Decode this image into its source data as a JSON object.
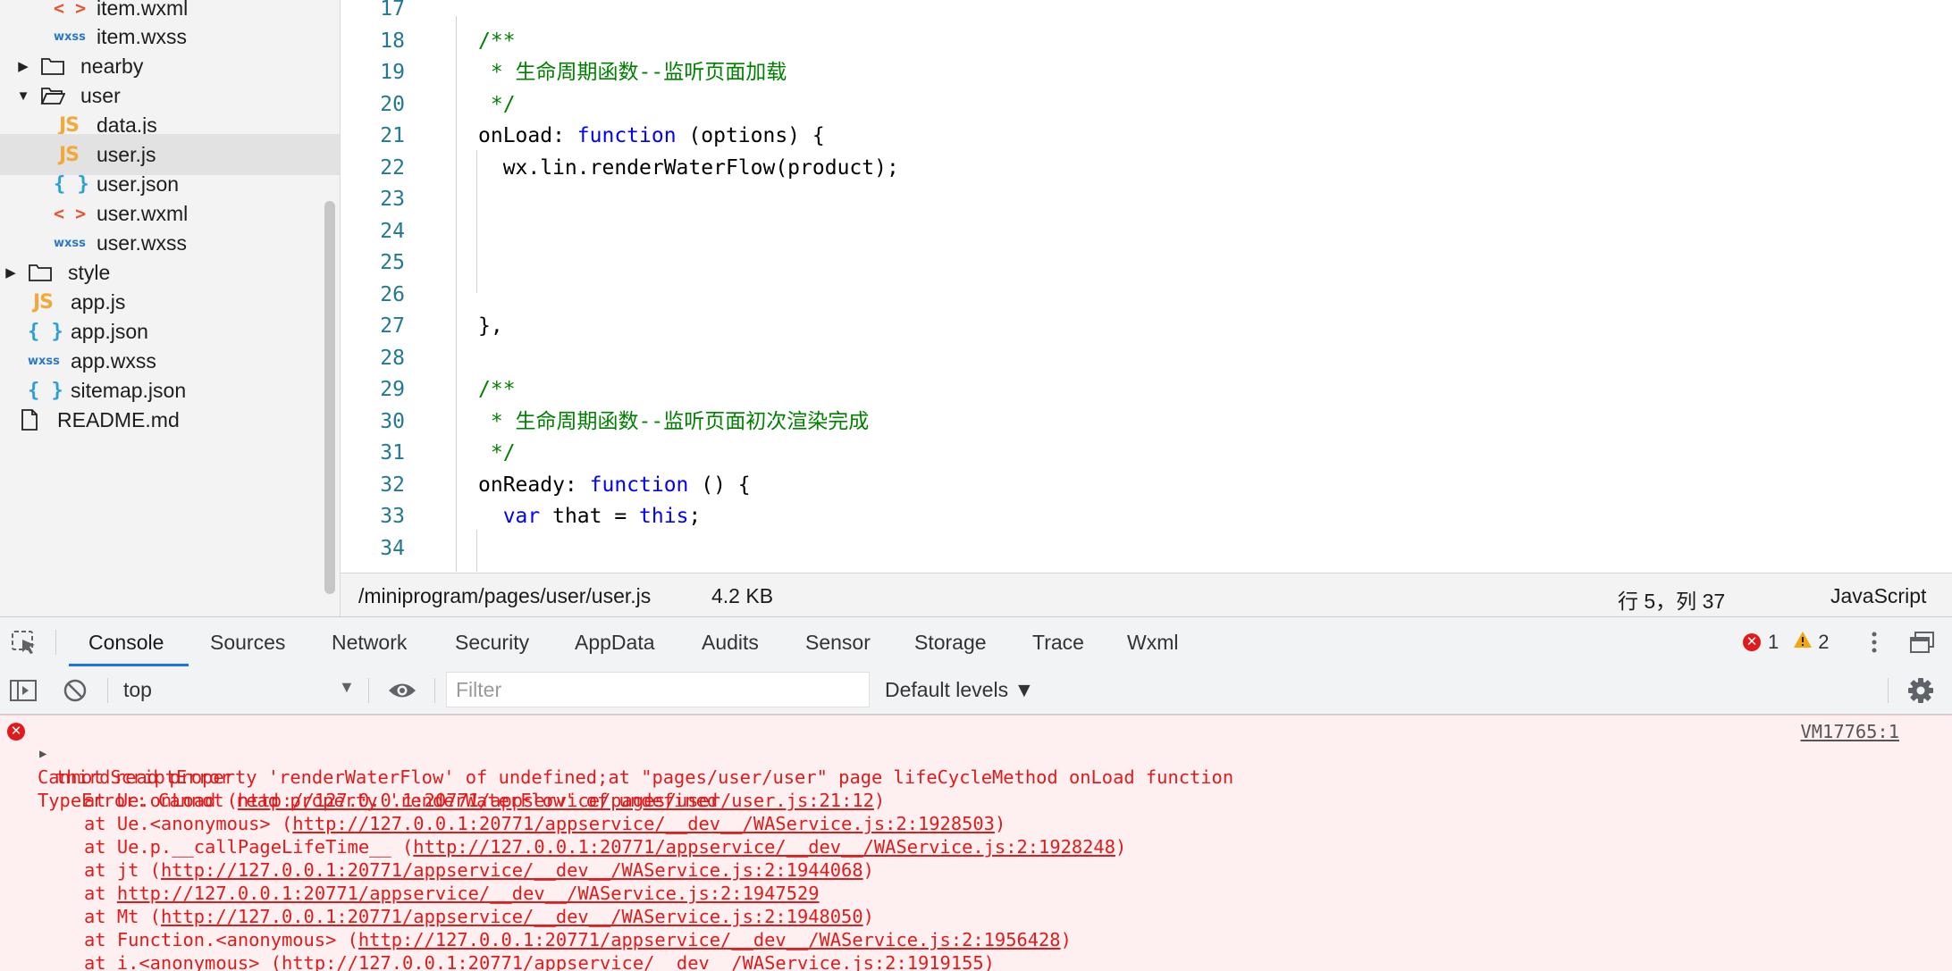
{
  "file_tree": {
    "items": [
      {
        "name": "item.wxml",
        "type": "wxml",
        "icon": "angle-brackets-icon"
      },
      {
        "name": "item.wxss",
        "type": "wxss",
        "icon": "wxss-icon"
      },
      {
        "name": "nearby",
        "type": "folder",
        "expanded": false,
        "icon": "folder-icon"
      },
      {
        "name": "user",
        "type": "folder",
        "expanded": true,
        "icon": "folder-open-icon"
      },
      {
        "name": "data.js",
        "type": "js",
        "icon": "js-icon"
      },
      {
        "name": "user.js",
        "type": "js",
        "icon": "js-icon",
        "selected": true
      },
      {
        "name": "user.json",
        "type": "json",
        "icon": "braces-icon"
      },
      {
        "name": "user.wxml",
        "type": "wxml",
        "icon": "angle-brackets-icon"
      },
      {
        "name": "user.wxss",
        "type": "wxss",
        "icon": "wxss-icon"
      },
      {
        "name": "style",
        "type": "folder",
        "expanded": false,
        "icon": "folder-icon"
      },
      {
        "name": "app.js",
        "type": "js",
        "icon": "js-icon"
      },
      {
        "name": "app.json",
        "type": "json",
        "icon": "braces-icon"
      },
      {
        "name": "app.wxss",
        "type": "wxss",
        "icon": "wxss-icon"
      },
      {
        "name": "sitemap.json",
        "type": "json",
        "icon": "braces-icon"
      },
      {
        "name": "README.md",
        "type": "file",
        "icon": "file-icon"
      }
    ],
    "icon_glyphs": {
      "js": "JS",
      "json": "{ }",
      "wxml": "< >",
      "wxss": "wxss"
    }
  },
  "editor": {
    "lines": [
      {
        "num": "17",
        "tokens": []
      },
      {
        "num": "18",
        "tokens": [
          {
            "t": "/**",
            "c": "comment"
          }
        ]
      },
      {
        "num": "19",
        "tokens": [
          {
            "t": " * 生命周期函数--监听页面加载",
            "c": "comment"
          }
        ]
      },
      {
        "num": "20",
        "tokens": [
          {
            "t": " */",
            "c": "comment"
          }
        ]
      },
      {
        "num": "21",
        "tokens": [
          {
            "t": "onLoad: ",
            "c": "plain"
          },
          {
            "t": "function",
            "c": "kw"
          },
          {
            "t": " (options) {",
            "c": "plain"
          }
        ]
      },
      {
        "num": "22",
        "tokens": [
          {
            "t": "  wx.lin.renderWaterFlow(product);",
            "c": "plain"
          }
        ]
      },
      {
        "num": "23",
        "tokens": []
      },
      {
        "num": "24",
        "tokens": []
      },
      {
        "num": "25",
        "tokens": []
      },
      {
        "num": "26",
        "tokens": []
      },
      {
        "num": "27",
        "tokens": [
          {
            "t": "},",
            "c": "plain"
          }
        ]
      },
      {
        "num": "28",
        "tokens": []
      },
      {
        "num": "29",
        "tokens": [
          {
            "t": "/**",
            "c": "comment"
          }
        ]
      },
      {
        "num": "30",
        "tokens": [
          {
            "t": " * 生命周期函数--监听页面初次渲染完成",
            "c": "comment"
          }
        ]
      },
      {
        "num": "31",
        "tokens": [
          {
            "t": " */",
            "c": "comment"
          }
        ]
      },
      {
        "num": "32",
        "tokens": [
          {
            "t": "onReady: ",
            "c": "plain"
          },
          {
            "t": "function",
            "c": "kw"
          },
          {
            "t": " () {",
            "c": "plain"
          }
        ]
      },
      {
        "num": "33",
        "tokens": [
          {
            "t": "  ",
            "c": "plain"
          },
          {
            "t": "var",
            "c": "kw"
          },
          {
            "t": " that = ",
            "c": "plain"
          },
          {
            "t": "this",
            "c": "kw"
          },
          {
            "t": ";",
            "c": "plain"
          }
        ]
      },
      {
        "num": "34",
        "tokens": []
      }
    ]
  },
  "statusbar": {
    "path": "/miniprogram/pages/user/user.js",
    "size": "4.2 KB",
    "position": "行 5，列 37",
    "language": "JavaScript"
  },
  "devtools": {
    "tabs": [
      "Console",
      "Sources",
      "Network",
      "Security",
      "AppData",
      "Audits",
      "Sensor",
      "Storage",
      "Trace",
      "Wxml"
    ],
    "active_tab": "Console",
    "error_count": "1",
    "warning_count": "2"
  },
  "console_toolbar": {
    "context": "top",
    "filter_placeholder": "Filter",
    "levels": "Default levels ▼"
  },
  "console": {
    "source_link": "VM17765:1",
    "error_title": "thirdScriptError",
    "message": "Cannot read property 'renderWaterFlow' of undefined;at \"pages/user/user\" page lifeCycleMethod onLoad function",
    "type_error": "TypeError: Cannot read property 'renderWaterFlow' of undefined",
    "stack": [
      {
        "prefix": "at Ue.onLoad (",
        "url": "http://127.0.0.1:20771/appservice/pages/user/user.js:21:12",
        "suffix": ")"
      },
      {
        "prefix": "at Ue.<anonymous> (",
        "url": "http://127.0.0.1:20771/appservice/__dev__/WAService.js:2:1928503",
        "suffix": ")"
      },
      {
        "prefix": "at Ue.p.__callPageLifeTime__ (",
        "url": "http://127.0.0.1:20771/appservice/__dev__/WAService.js:2:1928248",
        "suffix": ")"
      },
      {
        "prefix": "at jt (",
        "url": "http://127.0.0.1:20771/appservice/__dev__/WAService.js:2:1944068",
        "suffix": ")"
      },
      {
        "prefix": "at ",
        "url": "http://127.0.0.1:20771/appservice/__dev__/WAService.js:2:1947529",
        "suffix": ""
      },
      {
        "prefix": "at Mt (",
        "url": "http://127.0.0.1:20771/appservice/__dev__/WAService.js:2:1948050",
        "suffix": ")"
      },
      {
        "prefix": "at Function.<anonymous> (",
        "url": "http://127.0.0.1:20771/appservice/__dev__/WAService.js:2:1956428",
        "suffix": ")"
      },
      {
        "prefix": "at i.<anonymous> (",
        "url": "http://127.0.0.1:20771/appservice/__dev__/WAService.js:2:1919155",
        "suffix": ")"
      }
    ]
  },
  "colors": {
    "error": "#e01b1b",
    "console_bg": "#fef0f0",
    "comment": "#008000",
    "keyword": "#0000ff",
    "line_number": "#237893",
    "accent": "#1a73e8",
    "warning": "#f2a60d"
  }
}
